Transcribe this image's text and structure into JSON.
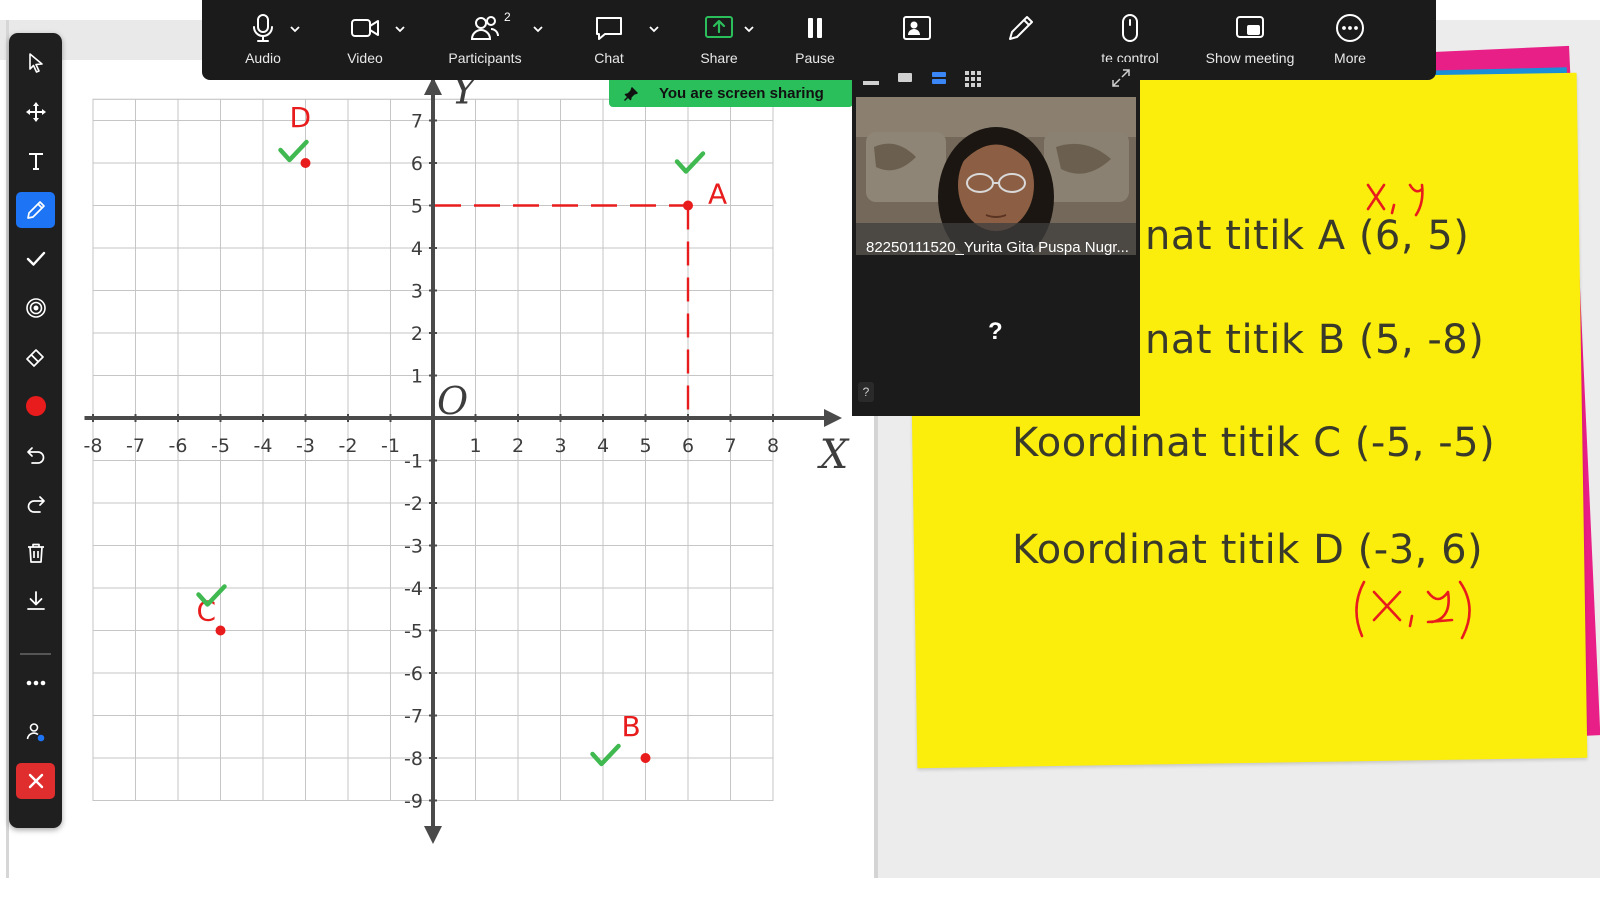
{
  "meeting_bar": {
    "audio_label": "Audio",
    "video_label": "Video",
    "participants_label": "Participants",
    "participants_count": "2",
    "chat_label": "Chat",
    "share_label": "Share",
    "pause_label": "Pause",
    "remote_control_label": "te control",
    "show_meeting_label": "Show meeting",
    "more_label": "More",
    "share_accent": "#2bbf5b"
  },
  "share_banner": {
    "text": "You are screen sharing"
  },
  "video_panel": {
    "participant_name": "82250111520_Yurita Gita Puspa Nugr...",
    "unknown_participant": "?",
    "small_label": "?"
  },
  "annotation_toolbar": {
    "tools": [
      "select-icon",
      "move-icon",
      "text-icon",
      "pen-icon",
      "stamp-icon",
      "spotlight-icon",
      "eraser-icon",
      "color-icon",
      "undo-icon",
      "redo-icon",
      "trash-icon",
      "save-icon",
      "more-icon",
      "participant-icon",
      "close-icon"
    ],
    "active_tool": "pen-icon",
    "active_color": "#e81c1c"
  },
  "coordinate_plane": {
    "x_axis_label": "X",
    "y_axis_label": "Y",
    "origin_label": "O",
    "x_ticks": [
      "-8",
      "-7",
      "-6",
      "-5",
      "-4",
      "-3",
      "-2",
      "-1",
      "1",
      "2",
      "3",
      "4",
      "5",
      "6",
      "7",
      "8"
    ],
    "y_ticks": [
      "7",
      "6",
      "5",
      "4",
      "3",
      "2",
      "1",
      "-1",
      "-2",
      "-3",
      "-4",
      "-5",
      "-6",
      "-7",
      "-8",
      "-9"
    ],
    "points": [
      {
        "label": "A",
        "x": 6,
        "y": 5
      },
      {
        "label": "B",
        "x": 5,
        "y": -8
      },
      {
        "label": "C",
        "x": -5,
        "y": -5
      },
      {
        "label": "D",
        "x": -3,
        "y": 6
      }
    ],
    "annotation_color": "#e81c1c",
    "check_color": "#3fb950"
  },
  "sticky_note": {
    "lines": [
      "nat titik A (6, 5)",
      "nat titik B (5, -8)",
      "Koordinat titik C (-5, -5)",
      "Koordinat titik D (-3, 6)"
    ],
    "handwritten_top": "x, y",
    "handwritten_bottom": "(x, y)",
    "colors": {
      "yellow": "#fbee0d",
      "blue": "#1a8fd8",
      "magenta": "#e81f86"
    }
  }
}
